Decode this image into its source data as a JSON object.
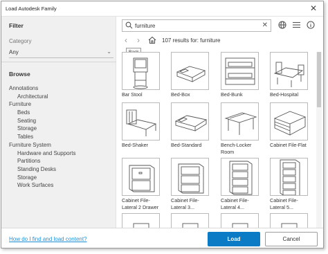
{
  "window": {
    "title": "Load Autodesk Family",
    "close_glyph": "✕"
  },
  "sidebar": {
    "filter_heading": "Filter",
    "category_label": "Category",
    "category_value": "Any",
    "browse_heading": "Browse",
    "tree": [
      {
        "label": "Annotations",
        "level": 0
      },
      {
        "label": "Architectural",
        "level": 1
      },
      {
        "label": "Furniture",
        "level": 0
      },
      {
        "label": "Beds",
        "level": 1
      },
      {
        "label": "Seating",
        "level": 1
      },
      {
        "label": "Storage",
        "level": 1
      },
      {
        "label": "Tables",
        "level": 1
      },
      {
        "label": "Furniture System",
        "level": 0
      },
      {
        "label": "Hardware and Supports",
        "level": 1
      },
      {
        "label": "Partitions",
        "level": 1
      },
      {
        "label": "Standing Desks",
        "level": 1
      },
      {
        "label": "Storage",
        "level": 1
      },
      {
        "label": "Work Surfaces",
        "level": 1
      }
    ]
  },
  "search": {
    "value": "furniture",
    "icon": "search-icon",
    "clear_glyph": "✕"
  },
  "toolbar": {
    "icons": [
      "globe-icon",
      "list-view-icon",
      "info-icon"
    ]
  },
  "nav": {
    "tooltip": "Back",
    "results_text": "107 results for: furniture",
    "icons": [
      "back-arrow-icon",
      "forward-arrow-icon",
      "home-icon"
    ]
  },
  "results": [
    {
      "label": "Bar Stool",
      "icon": "bar-stool-icon"
    },
    {
      "label": "Bed-Box",
      "icon": "bed-box-icon"
    },
    {
      "label": "Bed-Bunk",
      "icon": "bed-bunk-icon"
    },
    {
      "label": "Bed-Hospital",
      "icon": "bed-hospital-icon"
    },
    {
      "label": "Bed-Shaker",
      "icon": "bed-shaker-icon"
    },
    {
      "label": "Bed-Standard",
      "icon": "bed-standard-icon"
    },
    {
      "label": "Bench-Locker Room",
      "icon": "bench-locker-room-icon"
    },
    {
      "label": "Cabinet File-Flat",
      "icon": "cabinet-file-flat-icon"
    },
    {
      "label": "Cabinet File-Lateral 2 Drawer",
      "icon": "cabinet-lateral-2-drawer-icon"
    },
    {
      "label": "Cabinet File-Lateral 3...",
      "icon": "cabinet-lateral-3-icon"
    },
    {
      "label": "Cabinet File-Lateral 4...",
      "icon": "cabinet-lateral-4-icon"
    },
    {
      "label": "Cabinet File-Lateral 5...",
      "icon": "cabinet-lateral-5-icon"
    },
    {
      "label": "",
      "icon": "furniture-thumbnail-icon"
    },
    {
      "label": "",
      "icon": "furniture-thumbnail-icon"
    },
    {
      "label": "",
      "icon": "furniture-thumbnail-icon"
    },
    {
      "label": "",
      "icon": "furniture-thumbnail-icon"
    }
  ],
  "footer": {
    "help_link": "How do I find and load content?",
    "load_label": "Load",
    "cancel_label": "Cancel"
  },
  "colors": {
    "accent": "#0a7bc4",
    "link": "#1e8fd6",
    "sidebar_bg": "#f0f0f0"
  }
}
